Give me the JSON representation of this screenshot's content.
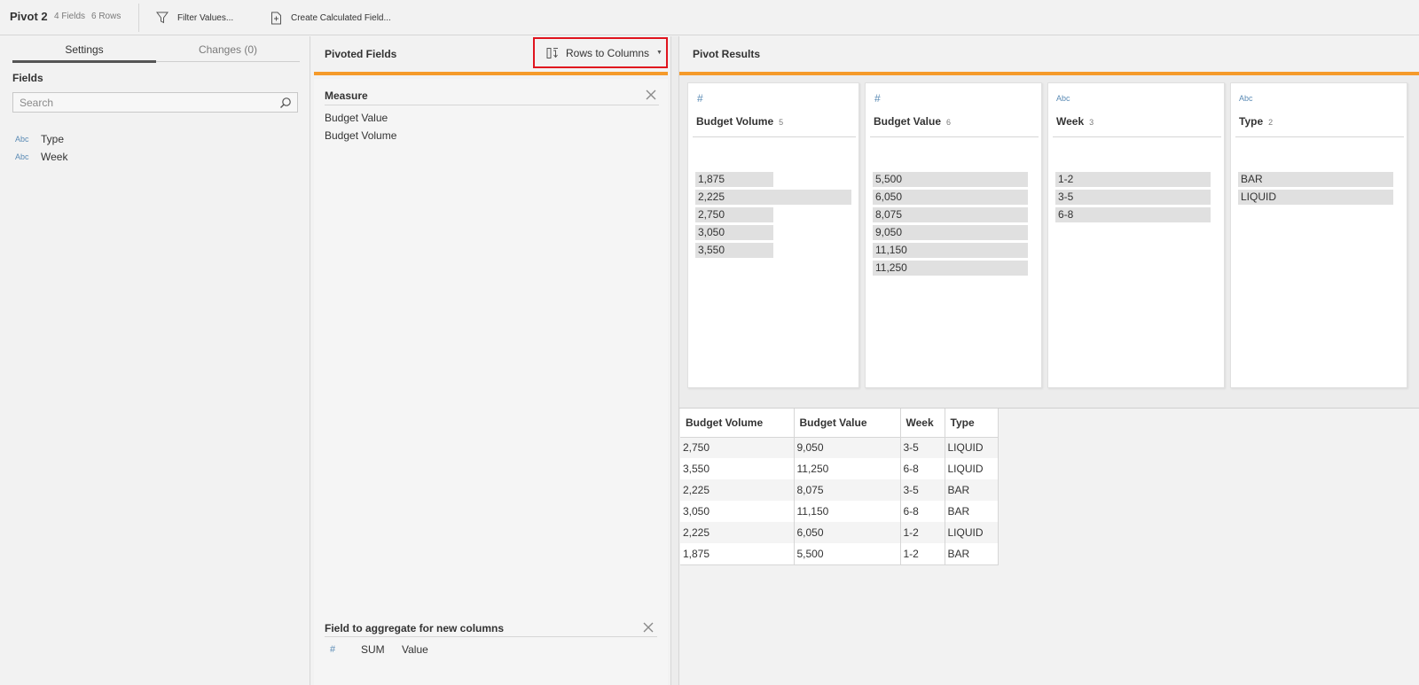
{
  "toolbar": {
    "title": "Pivot 2",
    "fields_count": "4 Fields",
    "rows_count": "6 Rows",
    "filter_label": "Filter Values...",
    "calc_label": "Create Calculated Field..."
  },
  "settings_panel": {
    "tabs": [
      {
        "label": "Settings",
        "active": true
      },
      {
        "label": "Changes (0)",
        "active": false
      }
    ],
    "fields_title": "Fields",
    "search_placeholder": "Search",
    "fields": [
      {
        "type": "Abc",
        "name": "Type"
      },
      {
        "type": "Abc",
        "name": "Week"
      }
    ]
  },
  "pivoted_fields": {
    "title": "Pivoted Fields",
    "pivot_type": "Rows to Columns",
    "measure_title": "Measure",
    "measure_values": [
      "Budget Value",
      "Budget Volume"
    ],
    "aggregate_title": "Field to aggregate for new columns",
    "aggregate_func": "SUM",
    "aggregate_field": "Value"
  },
  "pivot_results": {
    "title": "Pivot Results",
    "profile_cards": [
      {
        "type_label": "#",
        "name": "Budget Volume",
        "count": "5",
        "values": [
          {
            "label": "1,875",
            "fill": 0.5
          },
          {
            "label": "2,225",
            "fill": 1.0
          },
          {
            "label": "2,750",
            "fill": 0.5
          },
          {
            "label": "3,050",
            "fill": 0.5
          },
          {
            "label": "3,550",
            "fill": 0.5
          }
        ]
      },
      {
        "type_label": "#",
        "name": "Budget Value",
        "count": "6",
        "values": [
          {
            "label": "5,500",
            "fill": 1.0
          },
          {
            "label": "6,050",
            "fill": 1.0
          },
          {
            "label": "8,075",
            "fill": 1.0
          },
          {
            "label": "9,050",
            "fill": 1.0
          },
          {
            "label": "11,150",
            "fill": 1.0
          },
          {
            "label": "11,250",
            "fill": 1.0
          }
        ]
      },
      {
        "type_label": "Abc",
        "name": "Week",
        "count": "3",
        "values": [
          {
            "label": "1-2",
            "fill": 1.0
          },
          {
            "label": "3-5",
            "fill": 1.0
          },
          {
            "label": "6-8",
            "fill": 1.0
          }
        ]
      },
      {
        "type_label": "Abc",
        "name": "Type",
        "count": "2",
        "values": [
          {
            "label": "BAR",
            "fill": 1.0
          },
          {
            "label": "LIQUID",
            "fill": 1.0
          }
        ]
      }
    ],
    "table": {
      "headers": [
        "Budget Volume",
        "Budget Value",
        "Week",
        "Type"
      ],
      "rows": [
        [
          "2,750",
          "9,050",
          "3-5",
          "LIQUID"
        ],
        [
          "3,550",
          "11,250",
          "6-8",
          "LIQUID"
        ],
        [
          "2,225",
          "8,075",
          "3-5",
          "BAR"
        ],
        [
          "3,050",
          "11,150",
          "6-8",
          "BAR"
        ],
        [
          "2,225",
          "6,050",
          "1-2",
          "LIQUID"
        ],
        [
          "1,875",
          "5,500",
          "1-2",
          "BAR"
        ]
      ]
    }
  },
  "colors": {
    "accent_orange": "#f59a2a",
    "highlight_red": "#e0141e",
    "type_icon_blue": "#5b8bb5"
  }
}
